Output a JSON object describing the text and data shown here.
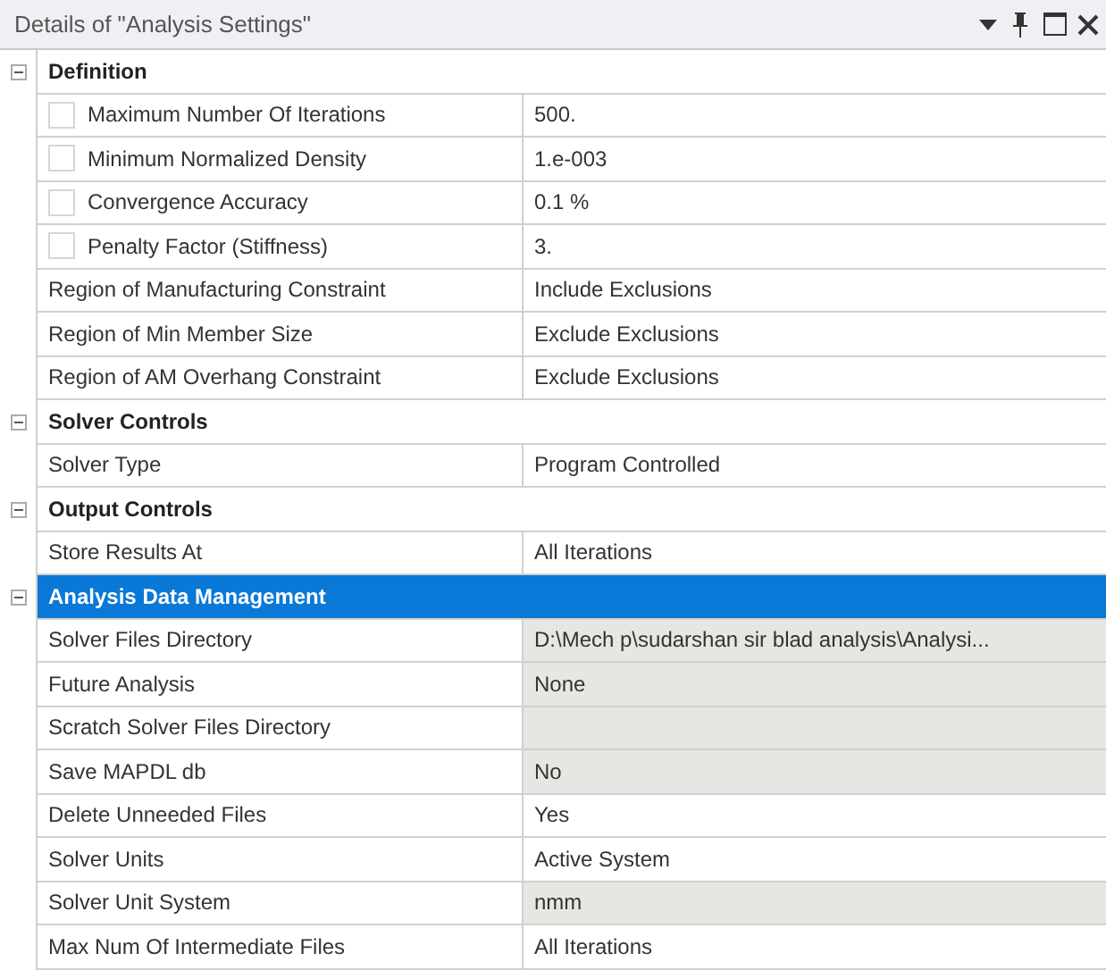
{
  "window": {
    "title": "Details of \"Analysis Settings\""
  },
  "sections": [
    {
      "title": "Definition",
      "expanded": true,
      "selected": false,
      "rows": [
        {
          "kind": "parameter",
          "checked": false,
          "label": "Maximum Number Of Iterations",
          "value": "500.",
          "readonly": false
        },
        {
          "kind": "parameter",
          "checked": false,
          "label": "Minimum Normalized Density",
          "value": "1.e-003",
          "readonly": false
        },
        {
          "kind": "parameter",
          "checked": false,
          "label": "Convergence Accuracy",
          "value": "0.1 %",
          "readonly": false
        },
        {
          "kind": "parameter",
          "checked": false,
          "label": "Penalty Factor (Stiffness)",
          "value": "3.",
          "readonly": false
        },
        {
          "kind": "plain",
          "label": "Region of Manufacturing Constraint",
          "value": "Include Exclusions",
          "readonly": false
        },
        {
          "kind": "plain",
          "label": "Region of Min Member Size",
          "value": "Exclude Exclusions",
          "readonly": false
        },
        {
          "kind": "plain",
          "label": "Region of AM Overhang Constraint",
          "value": "Exclude Exclusions",
          "readonly": false
        }
      ]
    },
    {
      "title": "Solver Controls",
      "expanded": true,
      "selected": false,
      "rows": [
        {
          "kind": "plain",
          "label": "Solver Type",
          "value": "Program Controlled",
          "readonly": false
        }
      ]
    },
    {
      "title": "Output Controls",
      "expanded": true,
      "selected": false,
      "rows": [
        {
          "kind": "plain",
          "label": "Store Results At",
          "value": "All Iterations",
          "readonly": false
        }
      ]
    },
    {
      "title": "Analysis Data Management",
      "expanded": true,
      "selected": true,
      "rows": [
        {
          "kind": "plain",
          "label": "Solver Files Directory",
          "value": "D:\\Mech p\\sudarshan sir blad analysis\\Analysi...",
          "readonly": true
        },
        {
          "kind": "plain",
          "label": "Future Analysis",
          "value": "None",
          "readonly": true
        },
        {
          "kind": "plain",
          "label": "Scratch Solver Files Directory",
          "readonly": true
        },
        {
          "kind": "plain",
          "label": "Save MAPDL db",
          "value": "No",
          "readonly": true
        },
        {
          "kind": "plain",
          "label": "Delete Unneeded Files",
          "value": "Yes",
          "readonly": false
        },
        {
          "kind": "plain",
          "label": "Solver Units",
          "value": "Active System",
          "readonly": false
        },
        {
          "kind": "plain",
          "label": "Solver Unit System",
          "value": "nmm",
          "readonly": true
        },
        {
          "kind": "plain",
          "label": "Max Num Of Intermediate Files",
          "value": "All Iterations",
          "readonly": false
        }
      ]
    }
  ]
}
